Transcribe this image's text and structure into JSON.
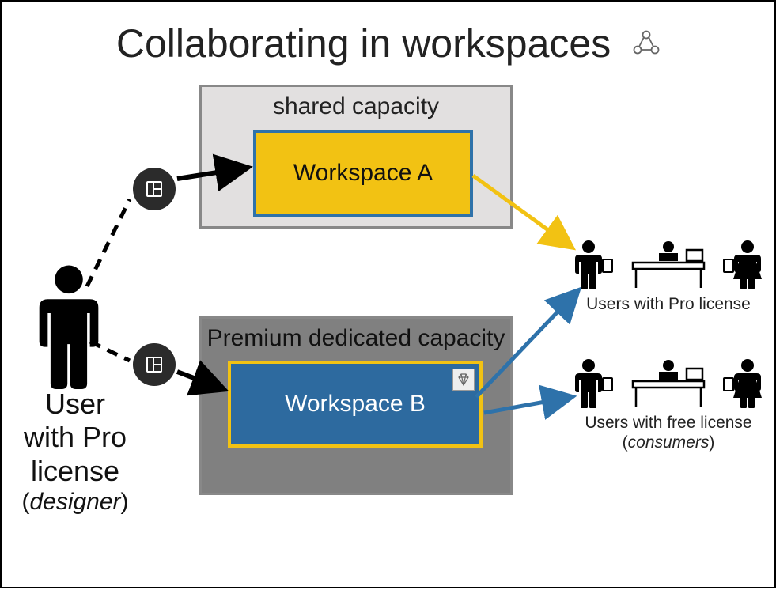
{
  "title": "Collaborating in workspaces",
  "designer": {
    "label_line1": "User",
    "label_line2": "with Pro",
    "label_line3": "license",
    "role_prefix": "(",
    "role": "designer",
    "role_suffix": ")"
  },
  "capacities": {
    "shared": {
      "label": "shared capacity"
    },
    "premium": {
      "label": "Premium dedicated capacity"
    }
  },
  "workspaces": {
    "a": {
      "label": "Workspace A"
    },
    "b": {
      "label": "Workspace B"
    }
  },
  "audiences": {
    "pro": {
      "caption": "Users with Pro license"
    },
    "free": {
      "caption_line1": "Users with free license",
      "caption_prefix": "(",
      "caption_role": "consumers",
      "caption_suffix": ")"
    }
  },
  "colors": {
    "workspace_a_bg": "#f2c213",
    "workspace_a_border": "#2e72aa",
    "workspace_b_bg": "#2d6a9f",
    "workspace_b_border": "#f2c213",
    "premium_bg": "#808080",
    "shared_bg": "#e2e0e0",
    "arrow_yellow": "#f2c213",
    "arrow_blue": "#2e72aa"
  }
}
